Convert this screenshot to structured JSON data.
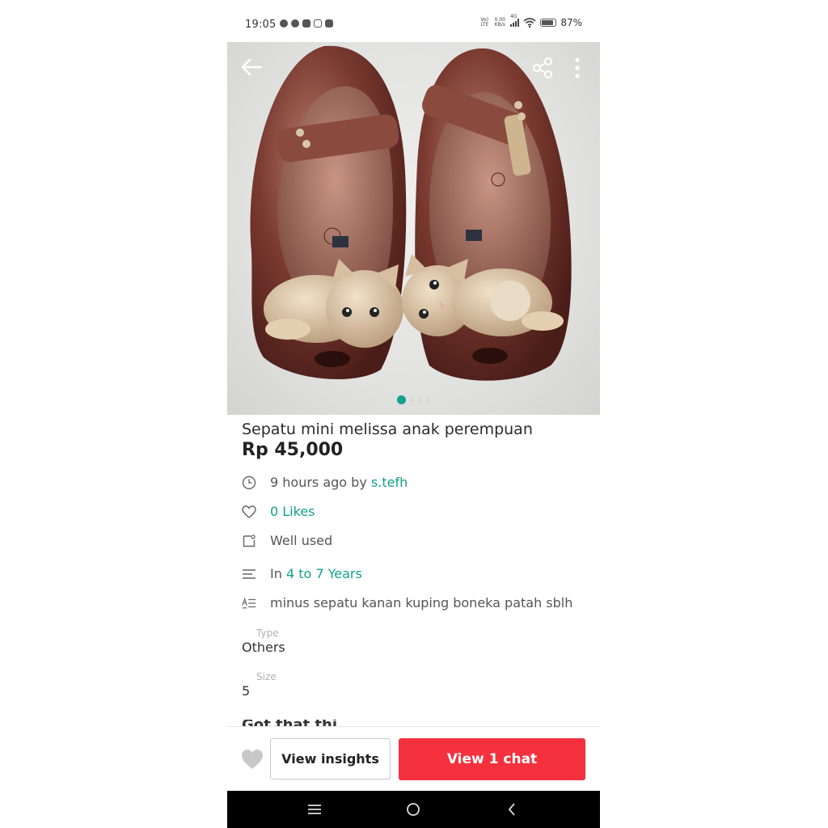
{
  "status_bar": {
    "time": "19:05",
    "network_top": "Vo)",
    "network_bottom": "LTE",
    "speed_top": "0.00",
    "speed_bottom": "KB/s",
    "signal_type": "4G",
    "battery": "87%",
    "notification_icons": [
      "whatsapp-icon",
      "chat-bubble-icon",
      "shop-icon",
      "instagram-icon",
      "app-icon"
    ]
  },
  "header": {
    "back_icon": "arrow-left-icon",
    "share_icon": "share-icon",
    "more_icon": "more-vertical-icon"
  },
  "gallery": {
    "image_description": "Pair of bronze kids jelly shoes with cat decorations",
    "page_count": 4,
    "active_index": 0
  },
  "listing": {
    "title": "Sepatu mini melissa anak perempuan",
    "price": "Rp 45,000",
    "posted_text": "9 hours ago by ",
    "seller": "s.tefh",
    "likes": "0 Likes",
    "condition": "Well used",
    "category_prefix": "In ",
    "category": "4 to 7 Years",
    "description": "minus sepatu kanan kuping boneka patah sblh",
    "attributes": [
      {
        "label": "Type",
        "value": "Others"
      },
      {
        "label": "Size",
        "value": "5"
      }
    ],
    "next_section_partial": "Got that thi"
  },
  "actions": {
    "insights_label": "View insights",
    "chat_label": "View 1 chat",
    "like_icon": "heart-icon"
  },
  "colors": {
    "accent": "#13a08c",
    "chat_button": "#f5313e",
    "nav_bar": "#000000"
  }
}
